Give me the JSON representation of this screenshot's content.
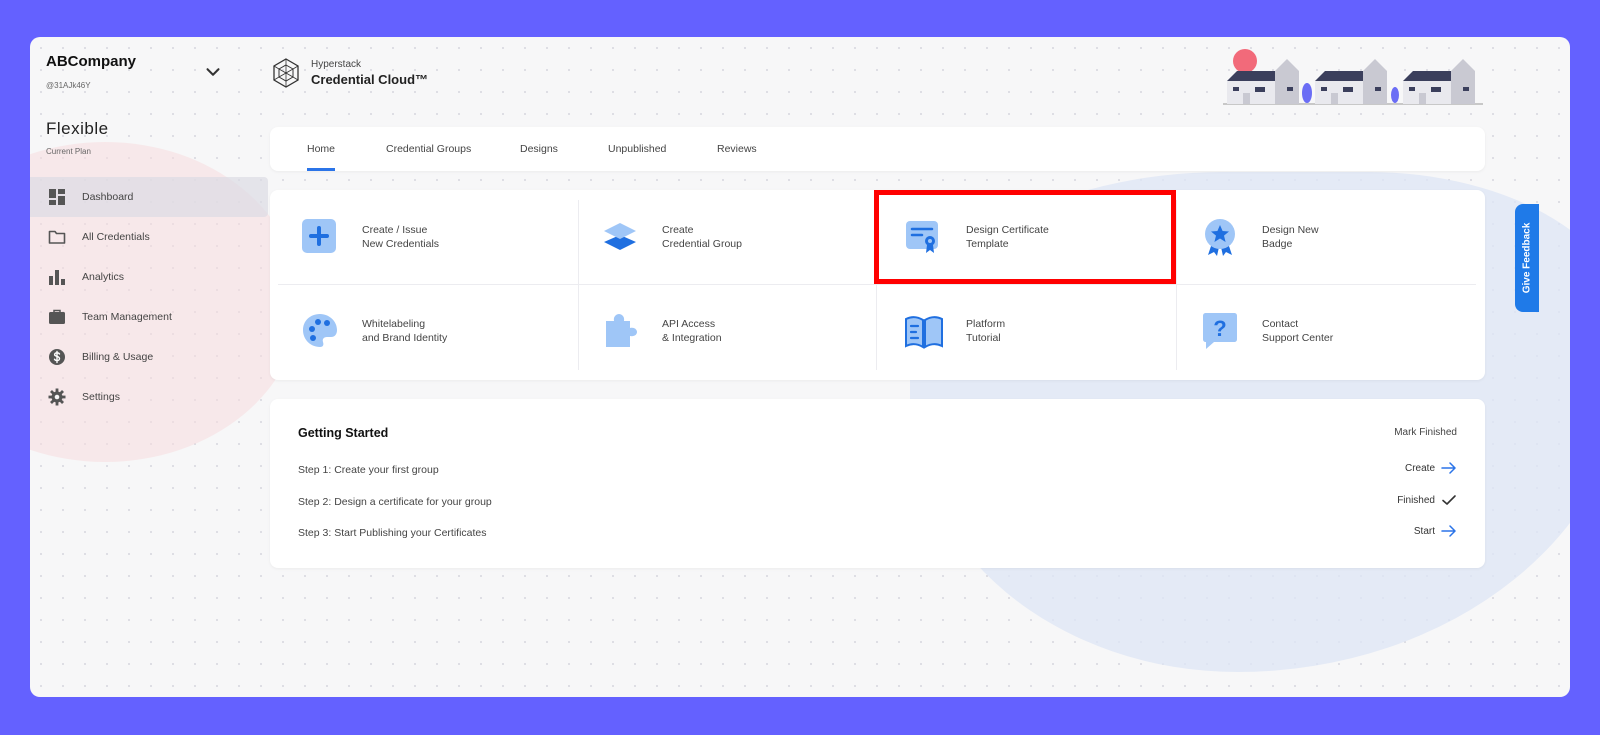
{
  "sidebar": {
    "company": "ABCompany",
    "company_id": "@31AJk46Y",
    "plan": "Flexible",
    "plan_label": "Current Plan",
    "items": [
      {
        "label": "Dashboard",
        "icon": "dashboard-icon"
      },
      {
        "label": "All Credentials",
        "icon": "folder-icon"
      },
      {
        "label": "Analytics",
        "icon": "bar-chart-icon"
      },
      {
        "label": "Team Management",
        "icon": "briefcase-icon"
      },
      {
        "label": "Billing & Usage",
        "icon": "dollar-icon"
      },
      {
        "label": "Settings",
        "icon": "gear-icon"
      }
    ]
  },
  "header": {
    "brand_top": "Hyperstack",
    "brand": "Credential Cloud™"
  },
  "tabs": [
    "Home",
    "Credential Groups",
    "Designs",
    "Unpublished",
    "Reviews"
  ],
  "actions": [
    {
      "line1": "Create / Issue",
      "line2": "New Credentials",
      "icon": "plus-icon"
    },
    {
      "line1": "Create",
      "line2": "Credential Group",
      "icon": "layers-icon"
    },
    {
      "line1": "Design Certificate",
      "line2": "Template",
      "icon": "certificate-icon"
    },
    {
      "line1": "Design New",
      "line2": "Badge",
      "icon": "badge-icon"
    },
    {
      "line1": "Whitelabeling",
      "line2": "and Brand Identity",
      "icon": "palette-icon"
    },
    {
      "line1": "API Access",
      "line2": "& Integration",
      "icon": "puzzle-icon"
    },
    {
      "line1": "Platform",
      "line2": "Tutorial",
      "icon": "book-icon"
    },
    {
      "line1": "Contact",
      "line2": "Support Center",
      "icon": "help-icon"
    }
  ],
  "getting_started": {
    "title": "Getting Started",
    "mark_finished": "Mark Finished",
    "steps": [
      {
        "label": "Step 1: Create your first group",
        "action": "Create",
        "icon": "arrow-right-icon"
      },
      {
        "label": "Step 2: Design a certificate for your group",
        "action": "Finished",
        "icon": "check-icon"
      },
      {
        "label": "Step 3: Start Publishing your Certificates",
        "action": "Start",
        "icon": "arrow-right-icon"
      }
    ]
  },
  "feedback": "Give Feedback",
  "colors": {
    "background": "#6461ff",
    "accent": "#2b74e8",
    "icon_light": "#9fc6f7",
    "highlight": "#ff0000",
    "feedback": "#1f7ae8"
  }
}
